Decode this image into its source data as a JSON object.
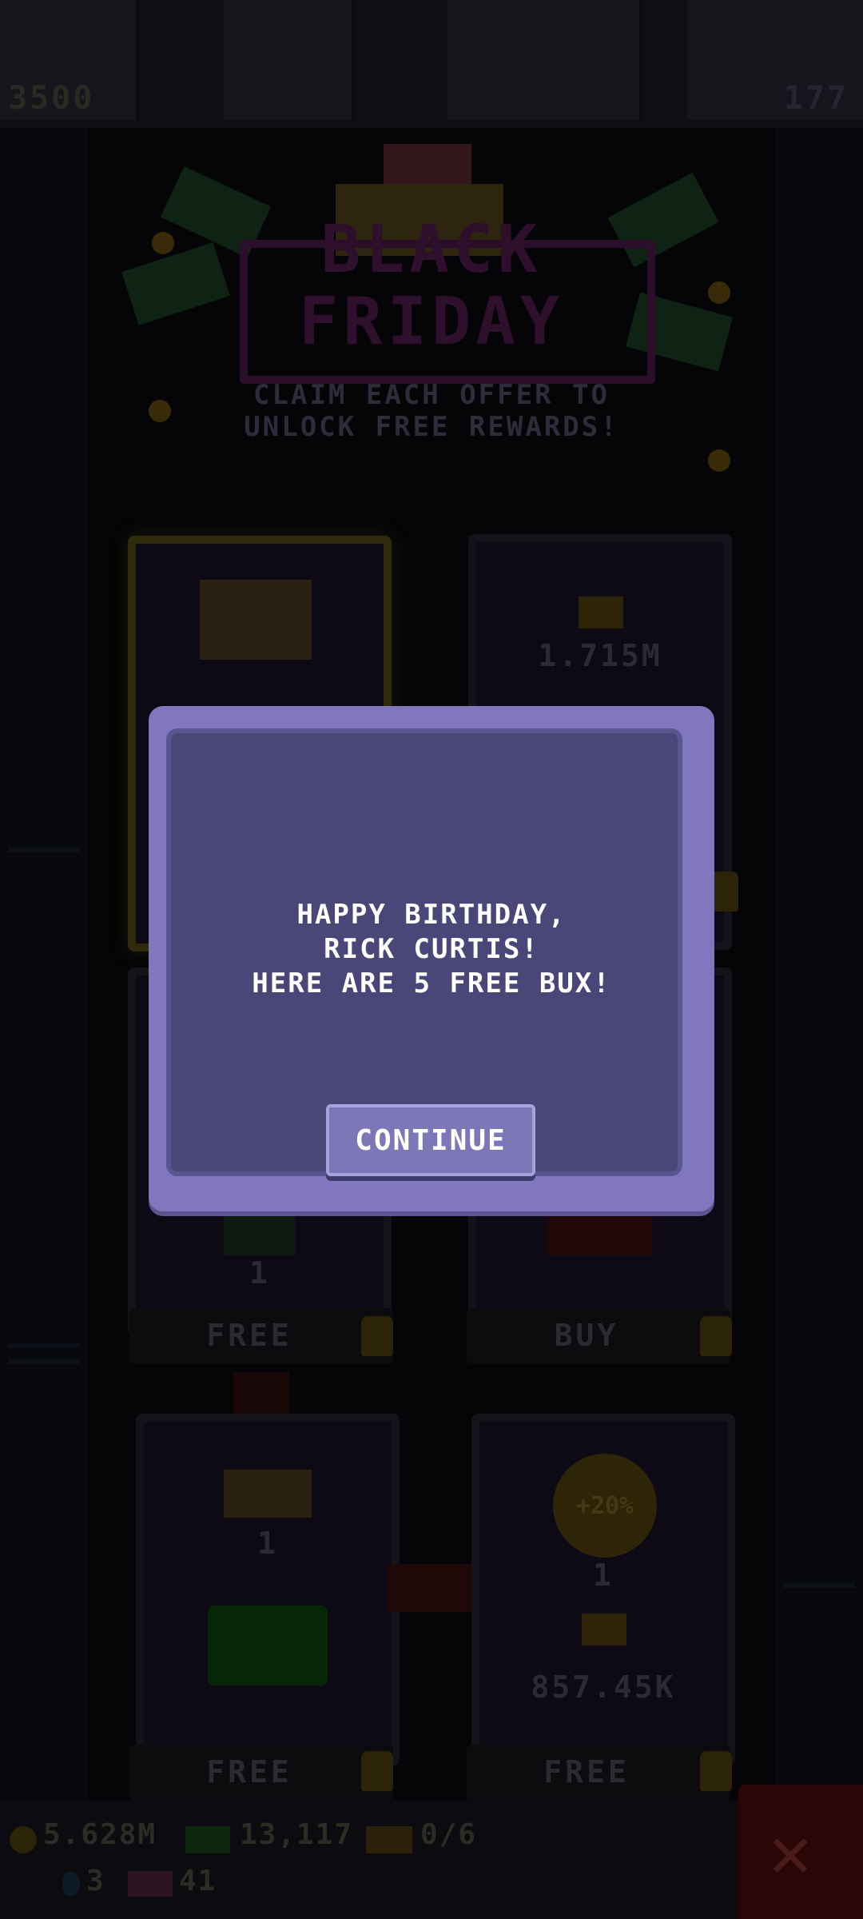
{
  "top_bar": {
    "coins": "3500",
    "count": "177"
  },
  "event": {
    "title_line1": "BLACK",
    "title_line2": "FRIDAY",
    "subtitle_line1": "CLAIM EACH OFFER TO",
    "subtitle_line2": "UNLOCK FREE REWARDS!"
  },
  "offers": [
    {
      "value": "",
      "button": "",
      "locked": true
    },
    {
      "value": "1.715M",
      "button": "",
      "locked": true
    },
    {
      "value": "1",
      "button": "FREE",
      "locked": true
    },
    {
      "value": "",
      "button": "BUY",
      "locked": true
    },
    {
      "value": "1",
      "button": "FREE",
      "locked": true
    },
    {
      "value": "1",
      "sub_value": "857.45K",
      "badge": "+20%",
      "button": "FREE",
      "locked": true
    }
  ],
  "bottom_bar": {
    "coins": "5.628M",
    "bux": "13,117",
    "progress": "0/6",
    "gems": "3",
    "tickets": "41"
  },
  "modal": {
    "line1": "HAPPY BIRTHDAY,",
    "line2": "RICK CURTIS!",
    "line3": "HERE ARE 5 FREE BUX!",
    "continue_label": "CONTINUE"
  },
  "colors": {
    "modal_frame": "#8177be",
    "modal_body": "#4a4677",
    "button": "#7d76b7"
  }
}
